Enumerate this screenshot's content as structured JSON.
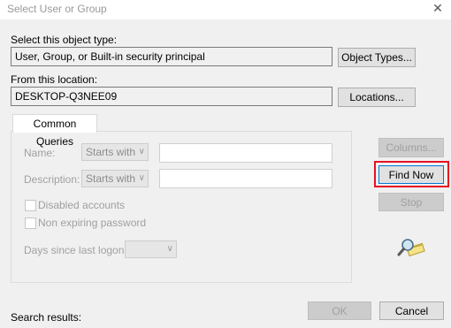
{
  "window": {
    "title": "Select User or Group",
    "close_glyph": "✕"
  },
  "object_type": {
    "label": "Select this object type:",
    "value": "User, Group, or Built-in security principal",
    "button": "Object Types..."
  },
  "location": {
    "label": "From this location:",
    "value": "DESKTOP-Q3NEE09",
    "button": "Locations..."
  },
  "queries": {
    "tab": "Common Queries",
    "name_label": "Name:",
    "name_mode": "Starts with",
    "description_label": "Description:",
    "description_mode": "Starts with",
    "disabled_accounts": "Disabled accounts",
    "non_expiring": "Non expiring password",
    "days_label": "Days since last logon:"
  },
  "side_buttons": {
    "columns": "Columns...",
    "find_now": "Find Now",
    "stop": "Stop"
  },
  "highlight_color": "#e81123",
  "search_icon": "search-users-icon",
  "footer": {
    "results_label": "Search results:",
    "ok": "OK",
    "cancel": "Cancel"
  }
}
